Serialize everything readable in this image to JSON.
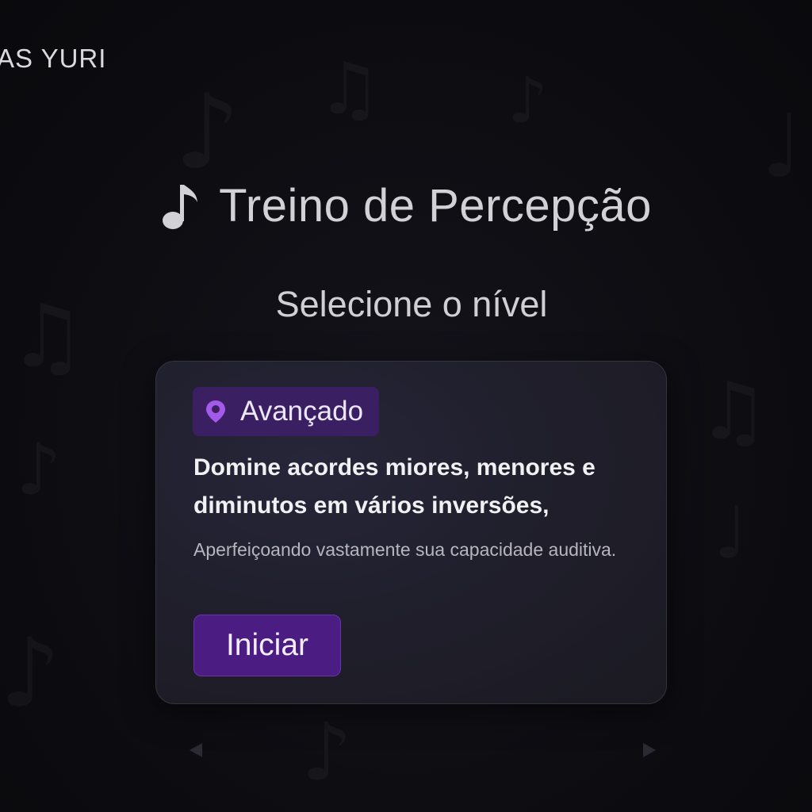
{
  "brand": {
    "text": "AS YURI"
  },
  "header": {
    "title": "Treino de Percepção",
    "title_icon": "music-note-icon",
    "subtitle": "Selecione o nível"
  },
  "level_card": {
    "badge_icon": "location-pin-icon",
    "badge_label": "Avançado",
    "description_main": "Domine acordes miores, menores e diminutos em vários inversões,",
    "description_sub": "Aperfeiçoando vastamente sua capacidade auditiva.",
    "start_label": "Iniciar"
  },
  "navigation": {
    "prev_icon": "arrow-left-icon",
    "next_icon": "arrow-right-icon"
  },
  "colors": {
    "background": "#0c0c10",
    "card": "#201f2c",
    "accent_purple": "#4b1c82",
    "badge_purple": "#3b1f63",
    "pin_purple": "#a35ae8",
    "title_text": "#d2d2d6"
  }
}
